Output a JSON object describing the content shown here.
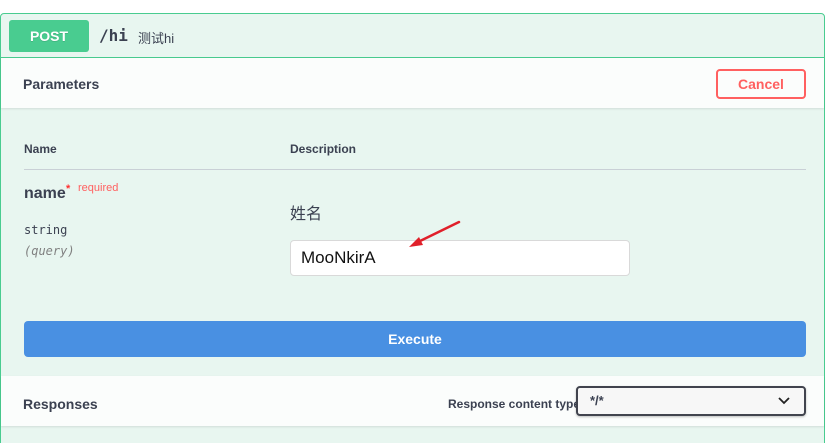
{
  "operation": {
    "method": "POST",
    "path": "/hi",
    "summary": "测试hi"
  },
  "parameters": {
    "title": "Parameters",
    "cancel_label": "Cancel",
    "columns": {
      "name": "Name",
      "description": "Description"
    },
    "param": {
      "name": "name",
      "required_star": "*",
      "required_label": "required",
      "type": "string",
      "in": "(query)",
      "description": "姓名",
      "value": "MooNkirA"
    },
    "execute_label": "Execute"
  },
  "responses": {
    "title": "Responses",
    "content_type_label": "Response content type",
    "content_type_value": "*/*"
  },
  "colors": {
    "post_accent": "#49cc90",
    "cancel": "#ff6060",
    "execute": "#4990e2",
    "annotation_arrow": "#e0202a"
  },
  "icons": {
    "select_chevron": "chevron-down-icon",
    "annotation": "red-arrow-annotation"
  }
}
